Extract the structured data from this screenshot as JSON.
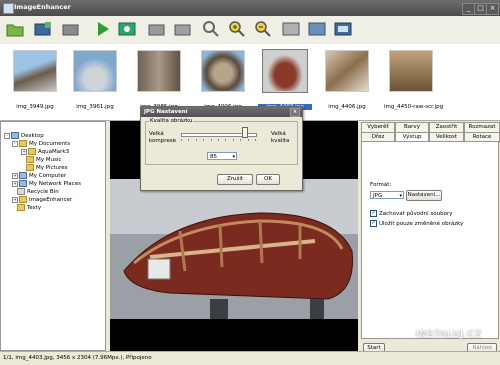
{
  "window": {
    "title": "ImageEnhancer"
  },
  "thumbnails": [
    {
      "name": "img_3949.jpg"
    },
    {
      "name": "img_3961.jpg"
    },
    {
      "name": "img_3985.jpg"
    },
    {
      "name": "img_4006.jpg"
    },
    {
      "name": "img_4403.jpg",
      "selected": true
    },
    {
      "name": "img_4406.jpg"
    },
    {
      "name": "img_4450-raw-scr.jpg"
    }
  ],
  "tree": {
    "desktop": "Desktop",
    "my_documents": "My Documents",
    "aquamark": "AquaMark3",
    "my_music": "My Music",
    "my_pictures": "My Pictures",
    "my_computer": "My Computer",
    "network": "My Network Places",
    "recycle": "Recycle Bin",
    "imageenhancer": "ImageEnhancer",
    "testy": "Testy"
  },
  "tabs": {
    "row1": [
      "Vyberěť",
      "Barvy",
      "Zaostřit",
      "Rozmazat"
    ],
    "row2": [
      "Ořez",
      "Výstup",
      "Velikost",
      "Rotace"
    ]
  },
  "output": {
    "format_label": "Formát:",
    "format_value": "JPG",
    "settings_button": "Nastavení...",
    "checkbox1": "Zachovat původní soubory",
    "checkbox2": "Uložit pouze změněné obrázky",
    "start_button": "Start",
    "hidden_button": "Náhled"
  },
  "dialog": {
    "title": "JPG Nastavení",
    "group_label": "Kvalita obrázku",
    "left_label_1": "Velká",
    "left_label_2": "komprese",
    "right_label_1": "Velká",
    "right_label_2": "kvalita",
    "value": "85",
    "quality_fraction": 0.85,
    "cancel": "Zrušit",
    "ok": "OK"
  },
  "status": {
    "text": "1/1, img_4403.jpg, 3456 x 2304 (7.96Mpx.), Připojeno"
  },
  "watermark": {
    "text": "INSTALUJ.CZ"
  }
}
